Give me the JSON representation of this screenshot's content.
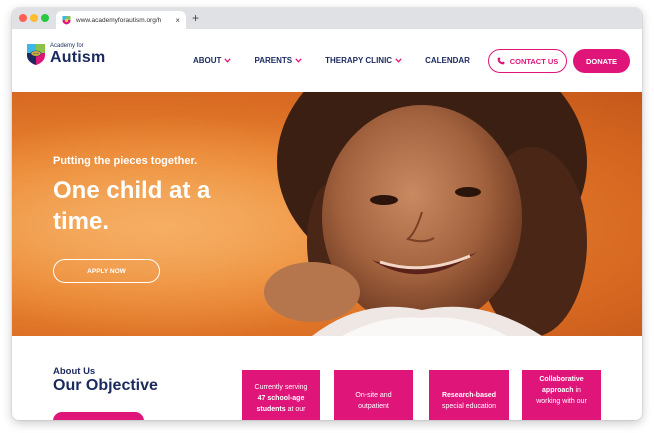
{
  "browser": {
    "tab_url": "www.academyforautism.org/h",
    "close_glyph": "×",
    "new_tab_glyph": "+"
  },
  "header": {
    "logo_small": "Academy for",
    "logo_big": "Autism",
    "nav": [
      {
        "label": "ABOUT",
        "dropdown": true
      },
      {
        "label": "PARENTS",
        "dropdown": true
      },
      {
        "label": "THERAPY CLINIC",
        "dropdown": true
      },
      {
        "label": "CALENDAR",
        "dropdown": false
      }
    ],
    "contact_label": "CONTACT US",
    "donate_label": "DONATE"
  },
  "hero": {
    "tagline": "Putting the pieces together.",
    "headline": "One child at a time.",
    "apply_label": "APPLY NOW"
  },
  "about": {
    "kicker": "About Us",
    "title": "Our Objective"
  },
  "cards": {
    "card1": {
      "pre": "Currently serving",
      "bold": "47 school-age students",
      "post": "at our"
    },
    "card2": {
      "text": "On-site and outpatient"
    },
    "card3": {
      "bold": "Research-based",
      "post": "special education"
    },
    "card4": {
      "bold": "Collaborative approach",
      "post": "in working with our"
    }
  },
  "colors": {
    "brand_pink": "#e0157a",
    "brand_navy": "#1b2a5e",
    "hero_orange": "#e9842f"
  },
  "icons": [
    "favicon-icon",
    "close-icon",
    "chevron-down-icon",
    "phone-icon",
    "logo-puzzle-icon"
  ]
}
